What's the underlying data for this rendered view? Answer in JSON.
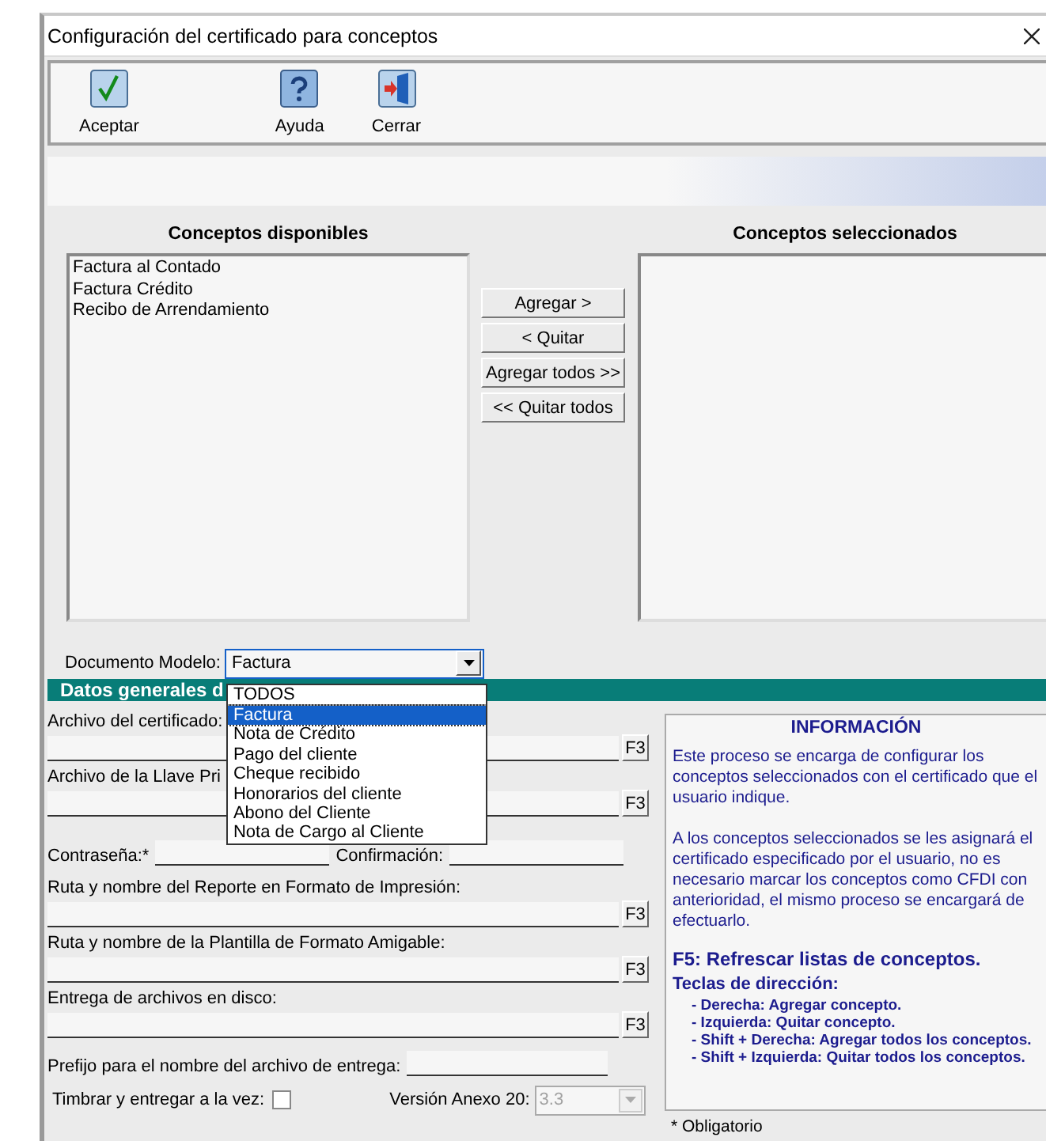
{
  "window": {
    "title": "Configuración del certificado para conceptos"
  },
  "toolbar": [
    {
      "label": "Aceptar",
      "kind": "accept"
    },
    {
      "label": "Ayuda",
      "kind": "help"
    },
    {
      "label": "Cerrar",
      "kind": "exit"
    }
  ],
  "available": {
    "heading": "Conceptos disponibles",
    "items": [
      "Factura al Contado",
      "Factura Crédito",
      "Recibo de Arrendamiento"
    ]
  },
  "chosen": {
    "heading": "Conceptos seleccionados"
  },
  "transfer_buttons": [
    "Agregar >",
    "< Quitar",
    "Agregar todos >>",
    "<< Quitar todos"
  ],
  "document_model": {
    "label": "Documento Modelo:",
    "value": "Factura",
    "expanded": true,
    "options": [
      {
        "label": "TODOS",
        "selected": false
      },
      {
        "label": "Factura",
        "selected": true
      },
      {
        "label": "Nota de Crédito",
        "selected": false
      },
      {
        "label": "Pago del cliente",
        "selected": false
      },
      {
        "label": "Cheque recibido",
        "selected": false
      },
      {
        "label": "Honorarios del cliente",
        "selected": false
      },
      {
        "label": "Abono del Cliente",
        "selected": false
      },
      {
        "label": "Nota de Cargo al Cliente",
        "selected": false
      }
    ]
  },
  "section_header": "Datos generales d",
  "fields": [
    {
      "kind": "path",
      "label": "Archivo del certificado:",
      "button": "F3"
    },
    {
      "kind": "path",
      "label": "Archivo de la Llave Pri",
      "button": "F3"
    },
    {
      "kind": "password",
      "label": "Contraseña:*",
      "confirm_label": "Confirmación:"
    },
    {
      "kind": "path",
      "label": "Ruta y nombre del Reporte en Formato de Impresión:",
      "button": "F3"
    },
    {
      "kind": "path",
      "label": "Ruta y nombre de la Plantilla de Formato Amigable:",
      "button": "F3"
    },
    {
      "kind": "path",
      "label": "Entrega de archivos en disco:",
      "button": "F3"
    },
    {
      "kind": "prefix",
      "label": "Prefijo para el nombre del archivo de entrega:"
    }
  ],
  "stamp": {
    "label": "Timbrar y entregar a la vez:",
    "checked": false
  },
  "version": {
    "label": "Versión Anexo 20:",
    "value": "3.3",
    "disabled": true
  },
  "info": {
    "title": "INFORMACIÓN",
    "paragraphs": [
      "Este proceso se encarga de configurar los conceptos seleccionados con el certificado que el usuario indique.",
      "A los conceptos seleccionados se les asignará el certificado especificado por el usuario, no es necesario marcar los conceptos como CFDI con anterioridad, el mismo proceso se encargará de efectuarlo."
    ],
    "refresh": "F5: Refrescar listas de conceptos.",
    "keys_title": "Teclas de dirección:",
    "keys": [
      "- Derecha: Agregar concepto.",
      "- Izquierda: Quitar concepto.",
      "- Shift + Derecha: Agregar todos los conceptos.",
      "- Shift + Izquierda: Quitar todos los conceptos."
    ]
  },
  "footnote": "* Obligatorio"
}
